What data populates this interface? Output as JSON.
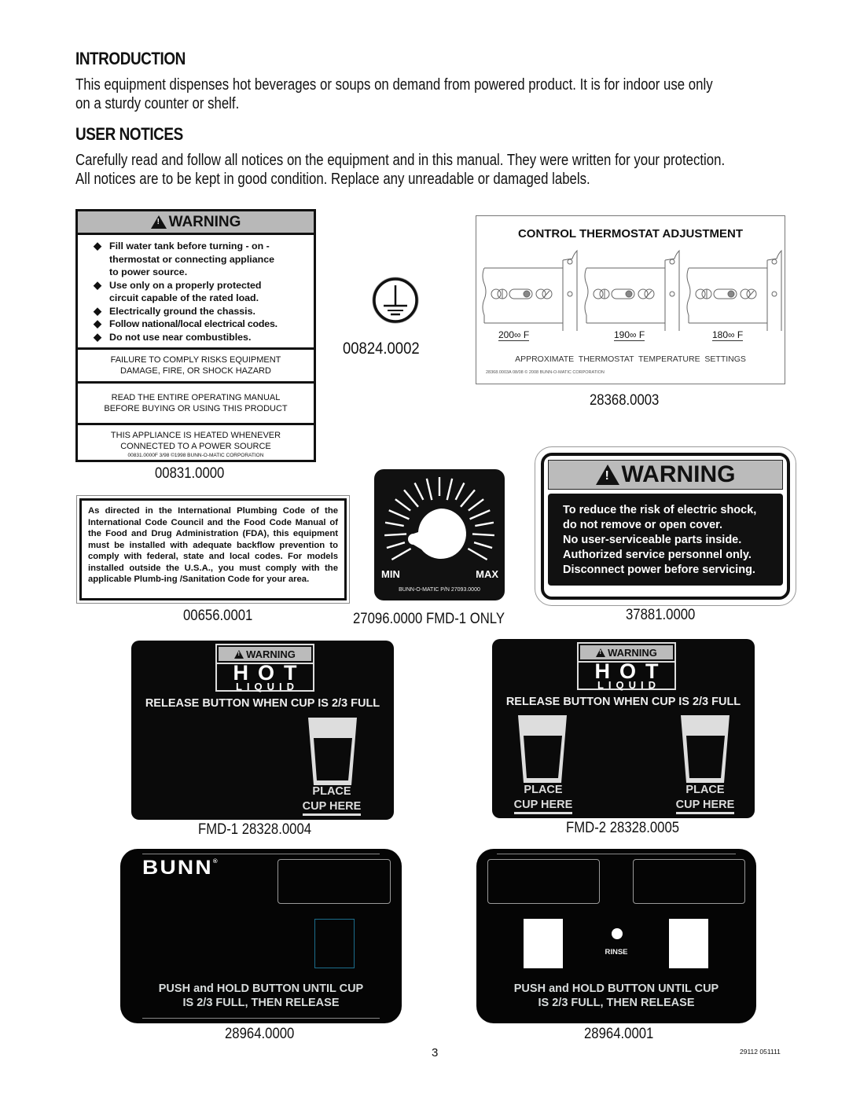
{
  "introduction": {
    "heading": "INTRODUCTION",
    "lines": [
      "This equipment dispenses hot beverages or soups on demand from powered product.  It is for indoor use only",
      "on a sturdy counter or shelf."
    ]
  },
  "user_notices": {
    "heading": "USER NOTICES",
    "lines": [
      "Carefully read and follow all notices on the equipment and in this manual.  They were written for your protection.",
      "All notices are to be kept in good condition.  Replace any unreadable or damaged labels."
    ]
  },
  "labels": {
    "warning_00831": {
      "header": "WARNING",
      "bullets": [
        [
          "Fill water tank before turning - on -",
          "thermostat or connecting appliance",
          "to power source."
        ],
        [
          "Use only on a properly protected",
          "circuit capable of the rated load."
        ],
        [
          "Electrically ground the chassis."
        ],
        [
          "Follow national/local electrical codes."
        ],
        [
          "Do not use near combustibles."
        ]
      ],
      "box1": [
        "FAILURE TO COMPLY RISKS EQUIPMENT",
        "DAMAGE, FIRE, OR SHOCK HAZARD"
      ],
      "box2": [
        "READ THE ENTIRE OPERATING MANUAL",
        "BEFORE BUYING OR USING THIS PRODUCT"
      ],
      "box3": [
        "THIS APPLIANCE IS HEATED WHENEVER",
        "CONNECTED TO A POWER SOURCE"
      ],
      "fine_print": "00831.0000F  3/98  ©1998  BUNN-O-MATIC CORPORATION",
      "part_number": "00831.0000"
    },
    "ground_00824": {
      "icon": "ground-symbol",
      "part_number": "00824.0002"
    },
    "thermostat_28368": {
      "title": "CONTROL THERMOSTAT ADJUSTMENT",
      "settings": [
        "200∞ F",
        "190∞ F",
        "180∞ F"
      ],
      "subtitle": "APPROXIMATE  THERMOSTAT  TEMPERATURE  SETTINGS",
      "fine_print": "28368.0003A  08/08  © 2008 BUNN-O-MATIC CORPORATION",
      "part_number": "28368.0003"
    },
    "plumbing_00656": {
      "text": "As directed in the International Plumbing Code of the International Code Council and the Food Code Manual of the Food and Drug Administration (FDA), this equipment must be installed with adequate backflow prevention to comply with federal, state and local codes. For models installed outside the U.S.A., you must comply with the applicable Plumb-ing /Sanitation Code for your area.",
      "part_number": "00656.0001"
    },
    "dial_27096": {
      "min_label": "MIN",
      "max_label": "MAX",
      "fine_print": "BUNN-O-MATIC P/N 27093.0000",
      "part_number": "27096.0000  FMD-1 ONLY"
    },
    "warning_37881": {
      "header": "WARNING",
      "lines": [
        "To reduce the risk of electric shock,",
        "do not remove or open cover.",
        "No user-serviceable parts inside.",
        "Authorized service personnel only.",
        "Disconnect power before servicing."
      ],
      "part_number": "37881.0000"
    },
    "hot_fmd1": {
      "badge_warning": "WARNING",
      "badge_hot": "HOT",
      "badge_liquid": "LIQUID",
      "instruction": "RELEASE BUTTON WHEN CUP IS 2/3 FULL",
      "place": "PLACE",
      "cup_here": "CUP HERE",
      "part_number": "FMD-1 28328.0004"
    },
    "hot_fmd2": {
      "badge_warning": "WARNING",
      "badge_hot": "HOT",
      "badge_liquid": "LIQUID",
      "instruction": "RELEASE BUTTON WHEN CUP IS 2/3 FULL",
      "place": "PLACE",
      "cup_here": "CUP HERE",
      "part_number": "FMD-2 28328.0005"
    },
    "panel_28964_0000": {
      "brand": "BUNN",
      "registered": "®",
      "instruction": [
        "PUSH and HOLD BUTTON UNTIL CUP",
        "IS 2/3 FULL, THEN RELEASE"
      ],
      "button_outline_color": "#1c6e8c",
      "part_number": "28964.0000"
    },
    "panel_28964_0001": {
      "rinse": "RINSE",
      "instruction": [
        "PUSH and HOLD BUTTON UNTIL CUP",
        "IS 2/3 FULL, THEN RELEASE"
      ],
      "part_number": "28964.0001"
    }
  },
  "footer": {
    "page_number": "3",
    "doc_code": "29112 051111"
  }
}
